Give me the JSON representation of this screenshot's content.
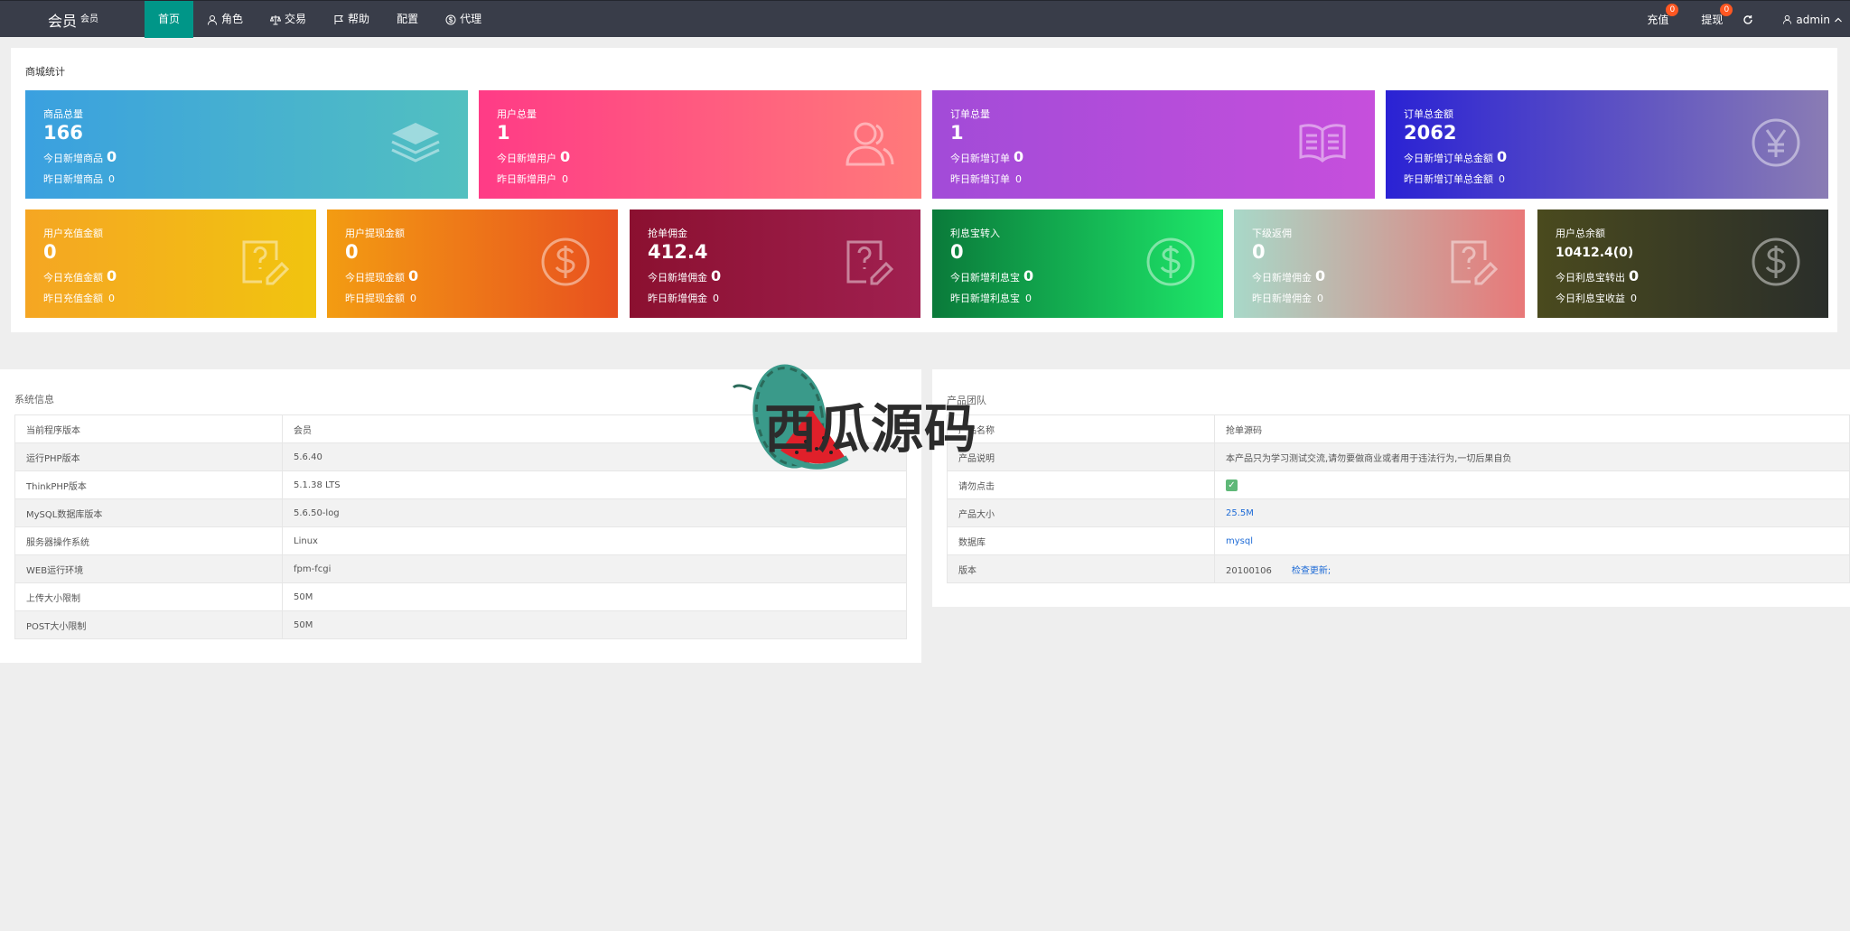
{
  "header": {
    "logo": "会员",
    "logo_sub": "会员",
    "nav": [
      {
        "label": "首页",
        "icon": "home",
        "active": true
      },
      {
        "label": "角色",
        "icon": "user-icon"
      },
      {
        "label": "交易",
        "icon": "scale-icon"
      },
      {
        "label": "帮助",
        "icon": "flag-icon"
      },
      {
        "label": "配置",
        "icon": ""
      },
      {
        "label": "代理",
        "icon": "dollar-circle-icon"
      }
    ],
    "recharge": {
      "label": "充值",
      "badge": "0"
    },
    "withdraw": {
      "label": "提现",
      "badge": "0"
    },
    "user": "admin"
  },
  "stats": {
    "title": "商城统计",
    "row1": [
      {
        "label": "商品总量",
        "value": "166",
        "today_label": "今日新增商品",
        "today": "0",
        "yest_label": "昨日新增商品",
        "yest": "0",
        "icon": "layers-icon"
      },
      {
        "label": "用户总量",
        "value": "1",
        "today_label": "今日新增用户",
        "today": "0",
        "yest_label": "昨日新增用户",
        "yest": "0",
        "icon": "users-icon"
      },
      {
        "label": "订单总量",
        "value": "1",
        "today_label": "今日新增订单",
        "today": "0",
        "yest_label": "昨日新增订单",
        "yest": "0",
        "icon": "book-icon"
      },
      {
        "label": "订单总金额",
        "value": "2062",
        "today_label": "今日新增订单总金额",
        "today": "0",
        "yest_label": "昨日新增订单总金额",
        "yest": "0",
        "icon": "yen-icon"
      }
    ],
    "row2": [
      {
        "label": "用户充值金额",
        "value": "0",
        "today_label": "今日充值金额",
        "today": "0",
        "yest_label": "昨日充值金额",
        "yest": "0",
        "icon": "question-edit-icon"
      },
      {
        "label": "用户提现金额",
        "value": "0",
        "today_label": "今日提现金额",
        "today": "0",
        "yest_label": "昨日提现金额",
        "yest": "0",
        "icon": "dollar-icon"
      },
      {
        "label": "抢单佣金",
        "value": "412.4",
        "today_label": "今日新增佣金",
        "today": "0",
        "yest_label": "昨日新增佣金",
        "yest": "0",
        "icon": "question-edit-icon"
      },
      {
        "label": "利息宝转入",
        "value": "0",
        "today_label": "今日新增利息宝",
        "today": "0",
        "yest_label": "昨日新增利息宝",
        "yest": "0",
        "icon": "dollar-icon"
      },
      {
        "label": "下级返佣",
        "value": "0",
        "today_label": "今日新增佣金",
        "today": "0",
        "yest_label": "昨日新增佣金",
        "yest": "0",
        "icon": "question-edit-icon"
      },
      {
        "label": "用户总余额",
        "value": "10412.4(0)",
        "today_label": "今日利息宝转出",
        "today": "0",
        "yest_label": "今日利息宝收益",
        "yest": "0",
        "icon": "dollar-icon"
      }
    ]
  },
  "system": {
    "title": "系统信息",
    "rows": [
      [
        "当前程序版本",
        "会员"
      ],
      [
        "运行PHP版本",
        "5.6.40"
      ],
      [
        "ThinkPHP版本",
        "5.1.38 LTS"
      ],
      [
        "MySQL数据库版本",
        "5.6.50-log"
      ],
      [
        "服务器操作系统",
        "Linux"
      ],
      [
        "WEB运行环境",
        "fpm-fcgi"
      ],
      [
        "上传大小限制",
        "50M"
      ],
      [
        "POST大小限制",
        "50M"
      ]
    ]
  },
  "product": {
    "title": "产品团队",
    "rows": [
      [
        "产品名称",
        "抢单源码"
      ],
      [
        "产品说明",
        "本产品只为学习测试交流,请勿要做商业或者用于违法行为,一切后果自负"
      ],
      [
        "请勿点击",
        ""
      ],
      [
        "产品大小",
        "25.5M"
      ],
      [
        "数据库",
        "mysql"
      ],
      [
        "版本",
        "20100106"
      ]
    ],
    "check_update": "检查更新;"
  },
  "watermark": "西瓜源码",
  "colors": {
    "topbar": "#393d49",
    "active_nav": "#009688",
    "badge": "#ff5722",
    "link": "#1e6bd6"
  }
}
